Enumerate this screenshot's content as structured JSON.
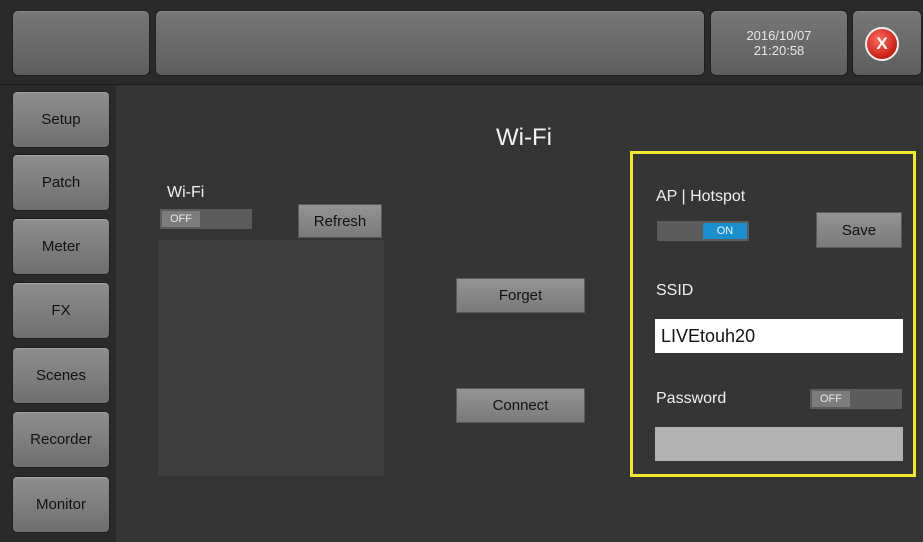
{
  "header": {
    "date": "2016/10/07",
    "time": "21:20:58",
    "close_label": "X"
  },
  "sidebar": {
    "items": [
      {
        "label": "Setup"
      },
      {
        "label": "Patch"
      },
      {
        "label": "Meter"
      },
      {
        "label": "FX"
      },
      {
        "label": "Scenes"
      },
      {
        "label": "Recorder"
      },
      {
        "label": "Monitor"
      }
    ]
  },
  "main": {
    "title": "Wi-Fi",
    "wifi": {
      "label": "Wi-Fi",
      "toggle_state": "OFF",
      "refresh_label": "Refresh"
    },
    "forget_label": "Forget",
    "connect_label": "Connect"
  },
  "hotspot": {
    "label": "AP | Hotspot",
    "toggle_state": "ON",
    "save_label": "Save",
    "ssid_label": "SSID",
    "ssid_value": "LIVEtouh20",
    "password_label": "Password",
    "password_toggle_state": "OFF",
    "password_value": ""
  },
  "colors": {
    "highlight": "#f4e82d",
    "toggle_on": "#1a8fcf",
    "close_button": "#c81f14"
  }
}
